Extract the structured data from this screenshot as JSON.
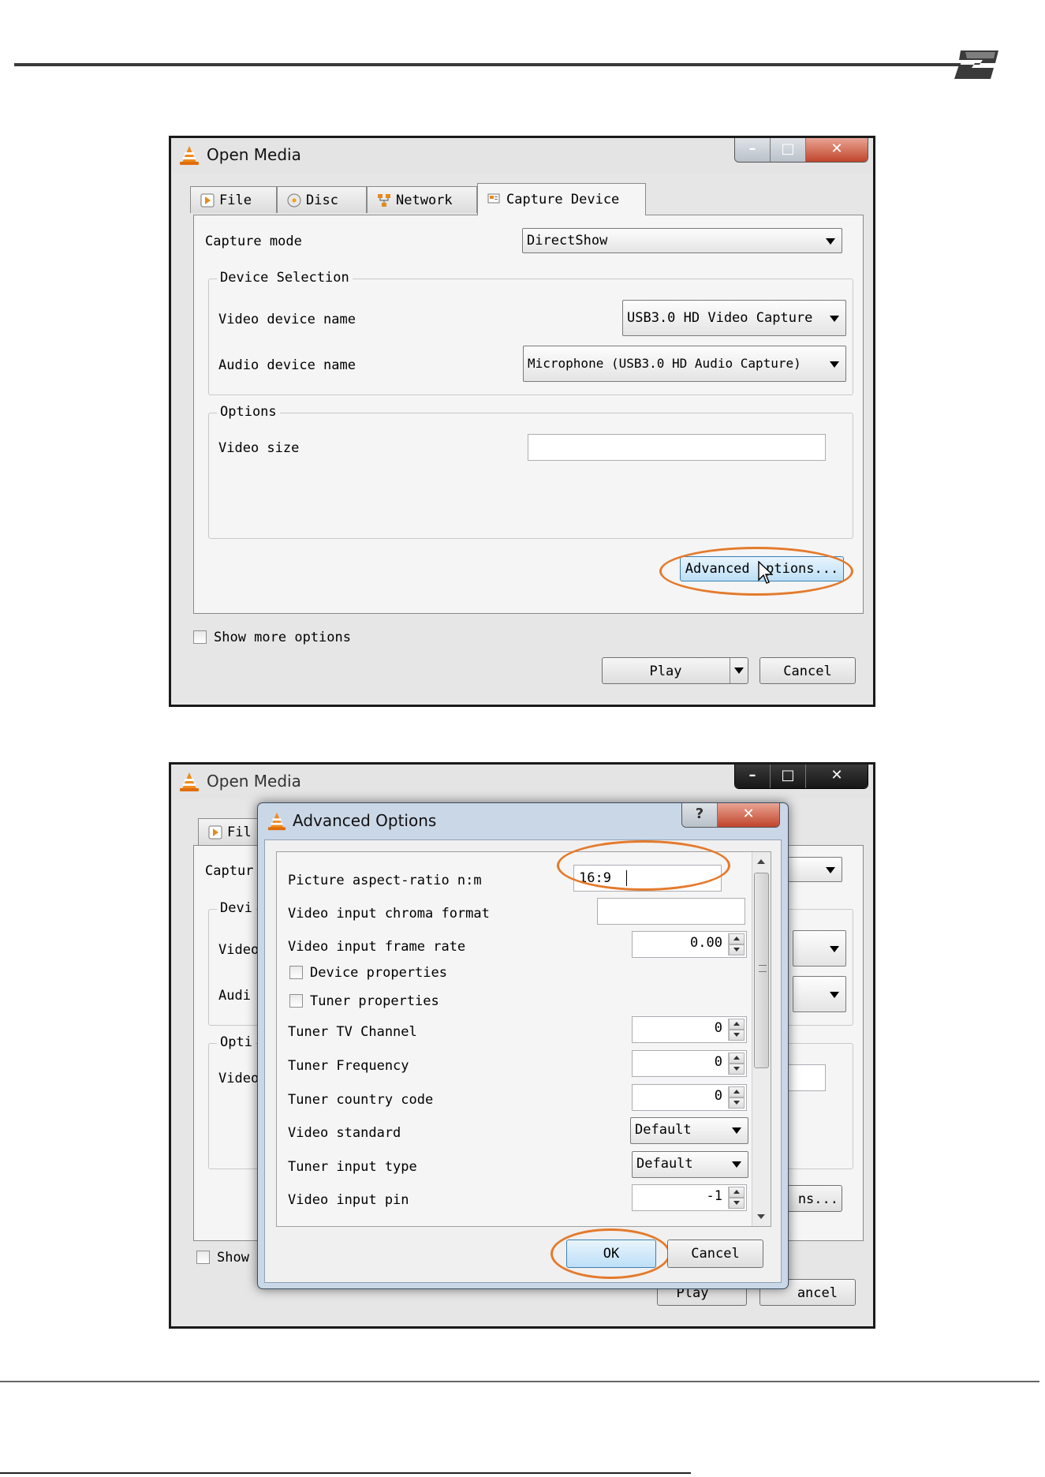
{
  "colors": {
    "highlight_oval": "#e47a2b",
    "close_button": "#c0452c",
    "selected_button": "#cfe6f8"
  },
  "window1": {
    "title": "Open Media",
    "tabs": [
      {
        "label": "File",
        "icon": "play-file-icon"
      },
      {
        "label": "Disc",
        "icon": "disc-icon"
      },
      {
        "label": "Network",
        "icon": "network-icon"
      },
      {
        "label": "Capture Device",
        "icon": "capture-device-icon",
        "active": true
      }
    ],
    "capture_mode_label": "Capture mode",
    "capture_mode_value": "DirectShow",
    "device_selection": {
      "title": "Device Selection",
      "video_label": "Video device name",
      "video_value": "USB3.0 HD Video Capture",
      "audio_label": "Audio device name",
      "audio_value": "Microphone (USB3.0 HD Audio Capture)"
    },
    "options": {
      "title": "Options",
      "video_size_label": "Video size",
      "video_size_value": ""
    },
    "advanced_button": "Advanced options...",
    "show_more_options": "Show more options",
    "play_button": "Play",
    "cancel_button": "Cancel"
  },
  "window2": {
    "title": "Open Media",
    "partial_tab": "Fil",
    "partial_labels": [
      "Captur",
      "Devi",
      "Video",
      "Audi",
      "Opti",
      "Video"
    ],
    "partial_button": "ns...",
    "show_partial": "Show",
    "play_partial": "Play",
    "cancel_partial": "ancel"
  },
  "advanced": {
    "title": "Advanced Options",
    "help_icon": "?",
    "rows": {
      "aspect_label": "Picture aspect-ratio n:m",
      "aspect_value": "16:9",
      "chroma_label": "Video input chroma format",
      "chroma_value": "",
      "frame_rate_label": "Video input frame rate",
      "frame_rate_value": "0.00",
      "device_props_label": "Device properties",
      "tuner_props_label": "Tuner properties",
      "tv_channel_label": "Tuner TV Channel",
      "tv_channel_value": "0",
      "frequency_label": "Tuner Frequency",
      "frequency_value": "0",
      "country_label": "Tuner country code",
      "country_value": "0",
      "standard_label": "Video standard",
      "standard_value": "Default",
      "input_type_label": "Tuner input type",
      "input_type_value": "Default",
      "input_pin_label": "Video input pin",
      "input_pin_value": "-1"
    },
    "ok_button": "OK",
    "cancel_button": "Cancel"
  }
}
